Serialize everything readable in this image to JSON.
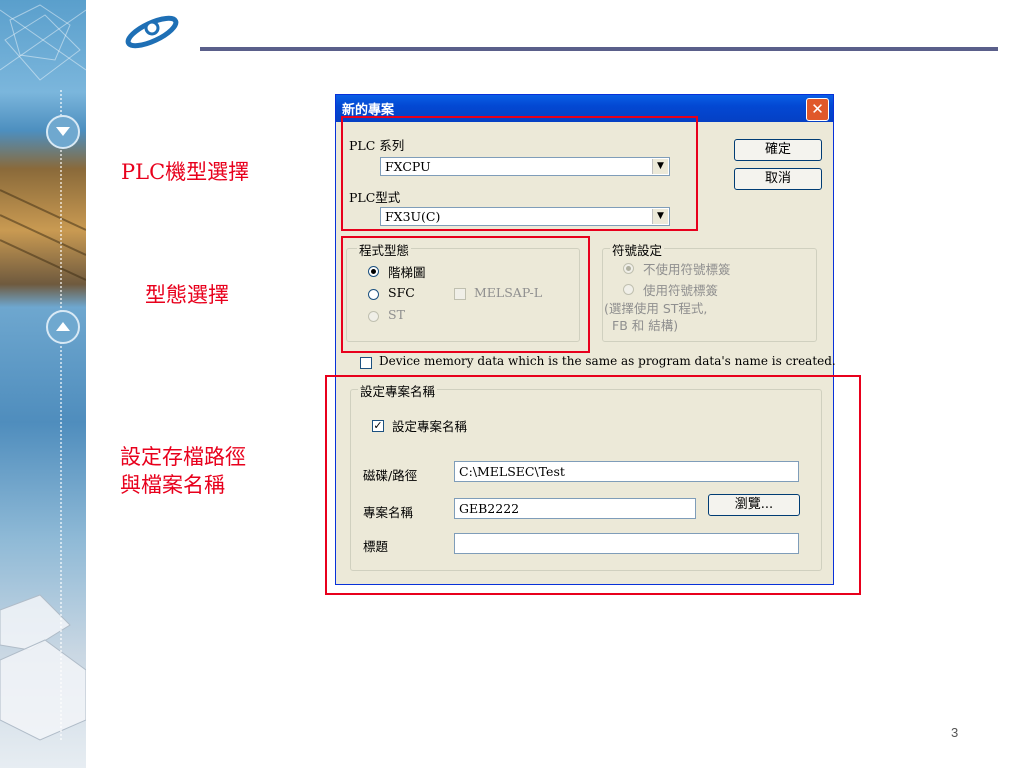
{
  "slide": {
    "page_number": "3"
  },
  "annotations": {
    "plc_model": "PLC機型選擇",
    "type_select": "型態選擇",
    "path_line1": "設定存檔路徑",
    "path_line2": "與檔案名稱"
  },
  "dialog": {
    "title": "新的專案",
    "close_symbol": "✕",
    "plc_series_label": "PLC 系列",
    "plc_series_value": "FXCPU",
    "plc_type_label": "PLC型式",
    "plc_type_value": "FX3U(C)",
    "ok_label": "確定",
    "cancel_label": "取消",
    "program_type": {
      "legend": "程式型態",
      "ladder": "階梯圖",
      "sfc": "SFC",
      "melsap": "MELSAP-L",
      "st": "ST"
    },
    "label_settings": {
      "legend": "符號設定",
      "opt1": "不使用符號標簽",
      "opt2": "使用符號標簽",
      "note1": "(選擇使用 ST程式,",
      "note2": "FB 和 結構)"
    },
    "device_memory_text": "Device memory data which is the same as program data's name is created.",
    "project_name_group": {
      "legend": "設定專案名稱",
      "checkbox_label": "設定專案名稱",
      "drive_path_label": "磁碟/路徑",
      "drive_path_value": "C:\\MELSEC\\Test",
      "project_name_label": "專案名稱",
      "project_name_value": "GEB2222",
      "browse_label": "瀏覽...",
      "title_label": "標題",
      "title_value": ""
    }
  },
  "colors": {
    "accent_red": "#e8001c",
    "titlebar_blue": "#0348d3",
    "dialog_bg": "#ece9d8"
  }
}
